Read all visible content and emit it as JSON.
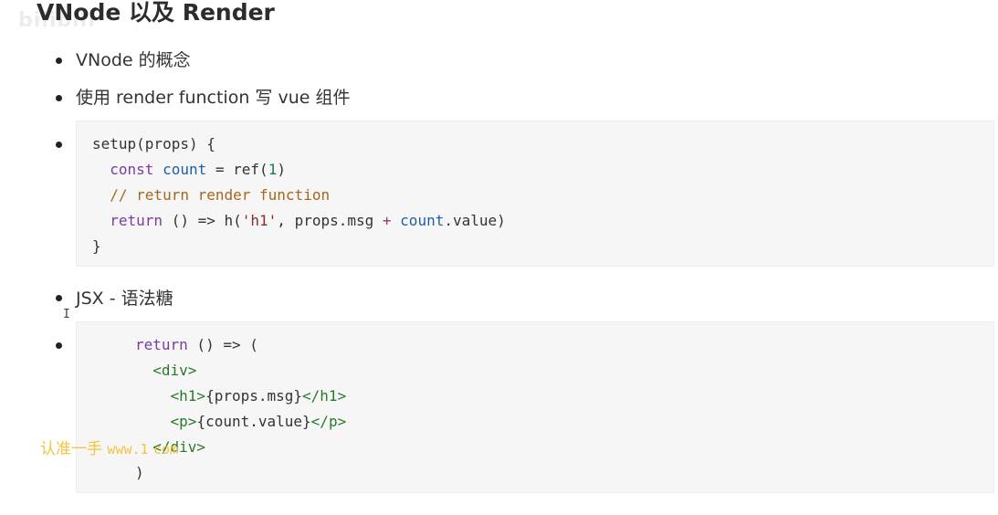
{
  "title": "VNode 以及 Render",
  "watermark_logo": "bilibili",
  "items": [
    {
      "text": "VNode 的概念"
    },
    {
      "text": "使用 render function 写 vue 组件"
    },
    {
      "text": "JSX - 语法糖"
    }
  ],
  "code_setup": [
    "setup(props) {",
    "const",
    "count",
    "= ref(",
    "1",
    ")",
    "// return render function",
    "return",
    "() => h(",
    "'h1'",
    ", props.msg ",
    "+",
    "count",
    ".value)",
    "}"
  ],
  "code_jsx": [
    "return",
    " () => (",
    "<div>",
    "<h1>",
    "{props.msg}",
    "</h1>",
    "<p>",
    "{count.value}",
    "</p>",
    "</div>",
    ")"
  ],
  "watermark_bottom": {
    "label": "认准一手",
    "url": "www.",
    "url_tail": "com",
    "url_mid": "1"
  },
  "colors": {
    "keyword": "#7a3ba1",
    "variable": "#1f5fa6",
    "comment": "#a7661b",
    "tag": "#287a2a",
    "watermark": "#f2c53d"
  },
  "icons": [
    "text-cursor-icon",
    "mouse-pointer-icon"
  ]
}
